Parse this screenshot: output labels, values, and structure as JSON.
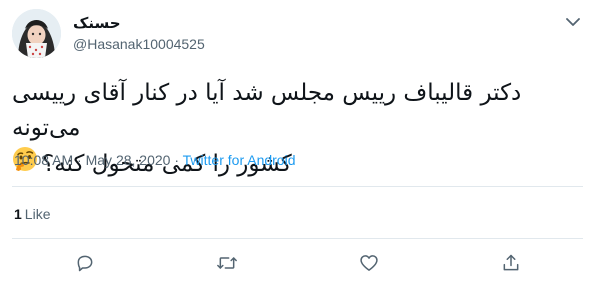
{
  "user": {
    "display_name": "حسنک",
    "handle": "@Hasanak10004525"
  },
  "tweet": {
    "line1": "دکتر قالیباف رییس مجلس شد آیا در کنار آقای رییسی می‌تونه",
    "line2": "کشور را کمی متحول کنه؟",
    "emoji": "thinking-face-emoji"
  },
  "meta": {
    "time": "10:08 AM",
    "separator1": " · ",
    "date": "May 28, 2020",
    "separator2": " · ",
    "source": "Twitter for Android"
  },
  "stats": {
    "likes_count": "1",
    "likes_label": "Like"
  },
  "icons": {
    "menu": "chevron-down-icon",
    "reply": "reply-icon",
    "retweet": "retweet-icon",
    "like": "heart-icon",
    "share": "share-icon"
  },
  "colors": {
    "link": "#1d9bf0",
    "secondary_text": "#536471",
    "divider": "#e1e8ed"
  }
}
